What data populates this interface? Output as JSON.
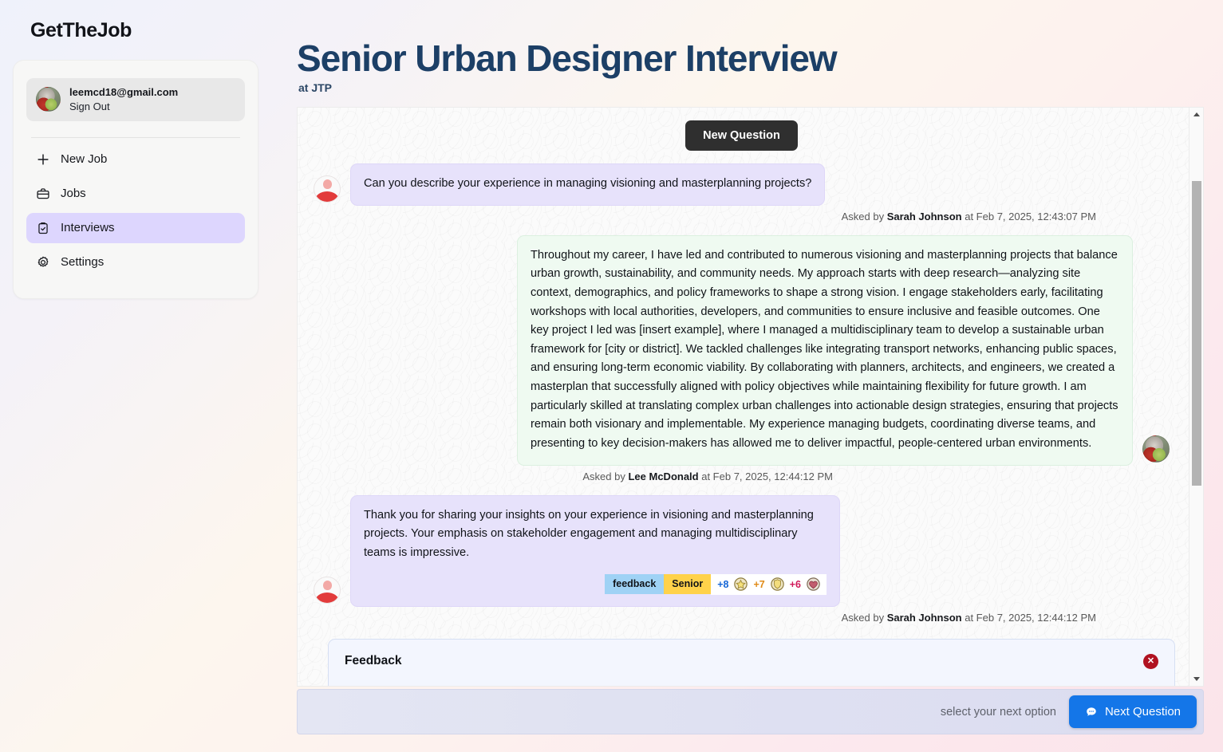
{
  "brand": "GetTheJob",
  "sidebar": {
    "account": {
      "email": "leemcd18@gmail.com",
      "sign_out_label": "Sign Out",
      "avatar": "user-photo-avatar"
    },
    "items": [
      {
        "label": "New Job",
        "icon": "plus-icon",
        "active": false
      },
      {
        "label": "Jobs",
        "icon": "briefcase-icon",
        "active": false
      },
      {
        "label": "Interviews",
        "icon": "clipboard-check-icon",
        "active": true
      },
      {
        "label": "Settings",
        "icon": "gear-icon",
        "active": false
      }
    ]
  },
  "header": {
    "title": "Senior Urban Designer Interview",
    "subtitle": "at JTP"
  },
  "chat": {
    "new_question_label": "New Question",
    "messages": [
      {
        "side": "left",
        "kind": "question",
        "text": "Can you describe your experience in managing visioning and masterplanning projects?",
        "meta_prefix": "Asked by ",
        "author": "Sarah Johnson",
        "meta_suffix": " at Feb 7, 2025, 12:43:07 PM",
        "avatar": "person-silhouette-avatar"
      },
      {
        "side": "right",
        "kind": "answer",
        "text": "Throughout my career, I have led and contributed to numerous visioning and masterplanning projects that balance urban growth, sustainability, and community needs. My approach starts with deep research—analyzing site context, demographics, and policy frameworks to shape a strong vision. I engage stakeholders early, facilitating workshops with local authorities, developers, and communities to ensure inclusive and feasible outcomes. One key project I led was [insert example], where I managed a multidisciplinary team to develop a sustainable urban framework for [city or district]. We tackled challenges like integrating transport networks, enhancing public spaces, and ensuring long-term economic viability. By collaborating with planners, architects, and engineers, we created a masterplan that successfully aligned with policy objectives while maintaining flexibility for future growth. I am particularly skilled at translating complex urban challenges into actionable design strategies, ensuring that projects remain both visionary and implementable. My experience managing budgets, coordinating diverse teams, and presenting to key decision-makers has allowed me to deliver impactful, people-centered urban environments.",
        "meta_prefix": "Asked by ",
        "author": "Lee McDonald",
        "meta_suffix": " at Feb 7, 2025, 12:44:12 PM",
        "avatar": "user-photo-avatar"
      },
      {
        "side": "left",
        "kind": "question",
        "text": "Thank you for sharing your insights on your experience in visioning and masterplanning projects. Your emphasis on stakeholder engagement and managing multidisciplinary teams is impressive.",
        "meta_prefix": "Asked by ",
        "author": "Sarah Johnson",
        "meta_suffix": " at Feb 7, 2025, 12:44:12 PM",
        "avatar": "person-silhouette-avatar"
      }
    ],
    "badges": {
      "tags": [
        {
          "label": "feedback",
          "color": "#9fd2f5"
        },
        {
          "label": "Senior",
          "color": "#ffd24a"
        }
      ],
      "scores": [
        {
          "value": "+8",
          "color": "#1566d6",
          "icon": "star-medal-icon"
        },
        {
          "value": "+7",
          "color": "#e08a16",
          "icon": "shield-medal-icon"
        },
        {
          "value": "+6",
          "color": "#d11a5a",
          "icon": "heart-medal-icon"
        }
      ]
    }
  },
  "feedback": {
    "title": "Feedback",
    "close_label": "✕",
    "close_icon": "close-circle-icon"
  },
  "bottom_bar": {
    "hint": "select your next option",
    "next_label": "Next Question",
    "next_icon": "chat-bubble-icon",
    "accent": "#1476e8"
  },
  "scrollbar": {
    "up_icon": "caret-up-icon",
    "down_icon": "caret-down-icon"
  }
}
